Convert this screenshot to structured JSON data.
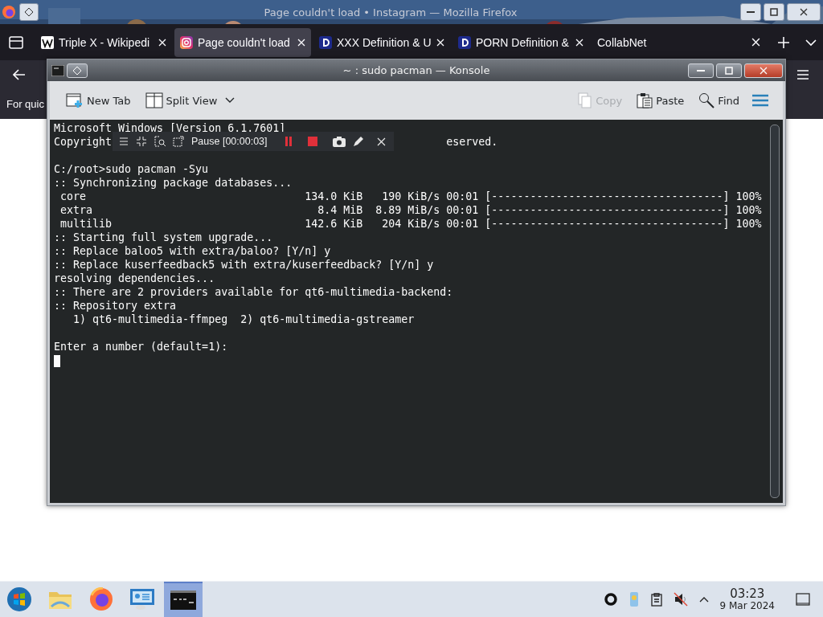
{
  "browser": {
    "title": "Page couldn't load • Instagram — Mozilla Firefox",
    "tabs": [
      {
        "label": "Triple X - Wikipedi",
        "kind": "wiki",
        "selected": false
      },
      {
        "label": "Page couldn't load",
        "selected": true
      },
      {
        "label": "XXX Definition & U",
        "kind": "dictionary",
        "selected": false
      },
      {
        "label": "PORN Definition &",
        "kind": "dictionary",
        "selected": false
      },
      {
        "label": "CollabNet",
        "kind": "plain",
        "selected": false
      }
    ],
    "bookmarks_text": "For quic"
  },
  "terminal_window": {
    "title": "~ : sudo pacman — Konsole",
    "toolbar": [
      {
        "kind": "newtab",
        "label": "New Tab",
        "disabled": false
      },
      {
        "kind": "split",
        "label": "Split View",
        "disabled": false
      },
      {
        "kind": "copy",
        "label": "Copy",
        "disabled": true
      },
      {
        "kind": "paste",
        "label": "Paste",
        "disabled": false
      },
      {
        "kind": "find",
        "label": "Find",
        "disabled": false
      }
    ],
    "lines": [
      {
        "kind": "text",
        "text": "Microsoft Windows [Version 6.1.7601]"
      },
      {
        "kind": "split",
        "left": "Copyright",
        "right": "eserved."
      },
      {
        "kind": "blank"
      },
      {
        "kind": "text",
        "text": "C:/root>sudo pacman -Syu"
      },
      {
        "kind": "text",
        "text": ":: Synchronizing package databases..."
      },
      {
        "kind": "text",
        "text": " core                                  134.0 KiB   190 KiB/s 00:01 [------------------------------------] 100%"
      },
      {
        "kind": "text",
        "text": " extra                                   8.4 MiB  8.89 MiB/s 00:01 [------------------------------------] 100%"
      },
      {
        "kind": "text",
        "text": " multilib                              142.6 KiB   204 KiB/s 00:01 [------------------------------------] 100%"
      },
      {
        "kind": "text",
        "text": ":: Starting full system upgrade..."
      },
      {
        "kind": "text",
        "text": ":: Replace baloo5 with extra/baloo? [Y/n] y"
      },
      {
        "kind": "text",
        "text": ":: Replace kuserfeedback5 with extra/kuserfeedback? [Y/n] y"
      },
      {
        "kind": "text",
        "text": "resolving dependencies..."
      },
      {
        "kind": "text",
        "text": ":: There are 2 providers available for qt6-multimedia-backend:"
      },
      {
        "kind": "text",
        "text": ":: Repository extra"
      },
      {
        "kind": "text",
        "text": "   1) qt6-multimedia-ffmpeg  2) qt6-multimedia-gstreamer"
      },
      {
        "kind": "blank"
      },
      {
        "kind": "text",
        "text": "Enter a number (default=1):"
      },
      {
        "kind": "cursor"
      }
    ],
    "recorder": {
      "status": "Pause [00:00:03]"
    }
  },
  "taskbar": {
    "apps": [
      {
        "kind": "start",
        "selected": false
      },
      {
        "kind": "folder",
        "selected": false
      },
      {
        "kind": "firefox",
        "selected": false
      },
      {
        "kind": "remote",
        "selected": false
      },
      {
        "kind": "terminal",
        "selected": true
      }
    ],
    "time": "03:23",
    "date": "9 Mar 2024"
  }
}
